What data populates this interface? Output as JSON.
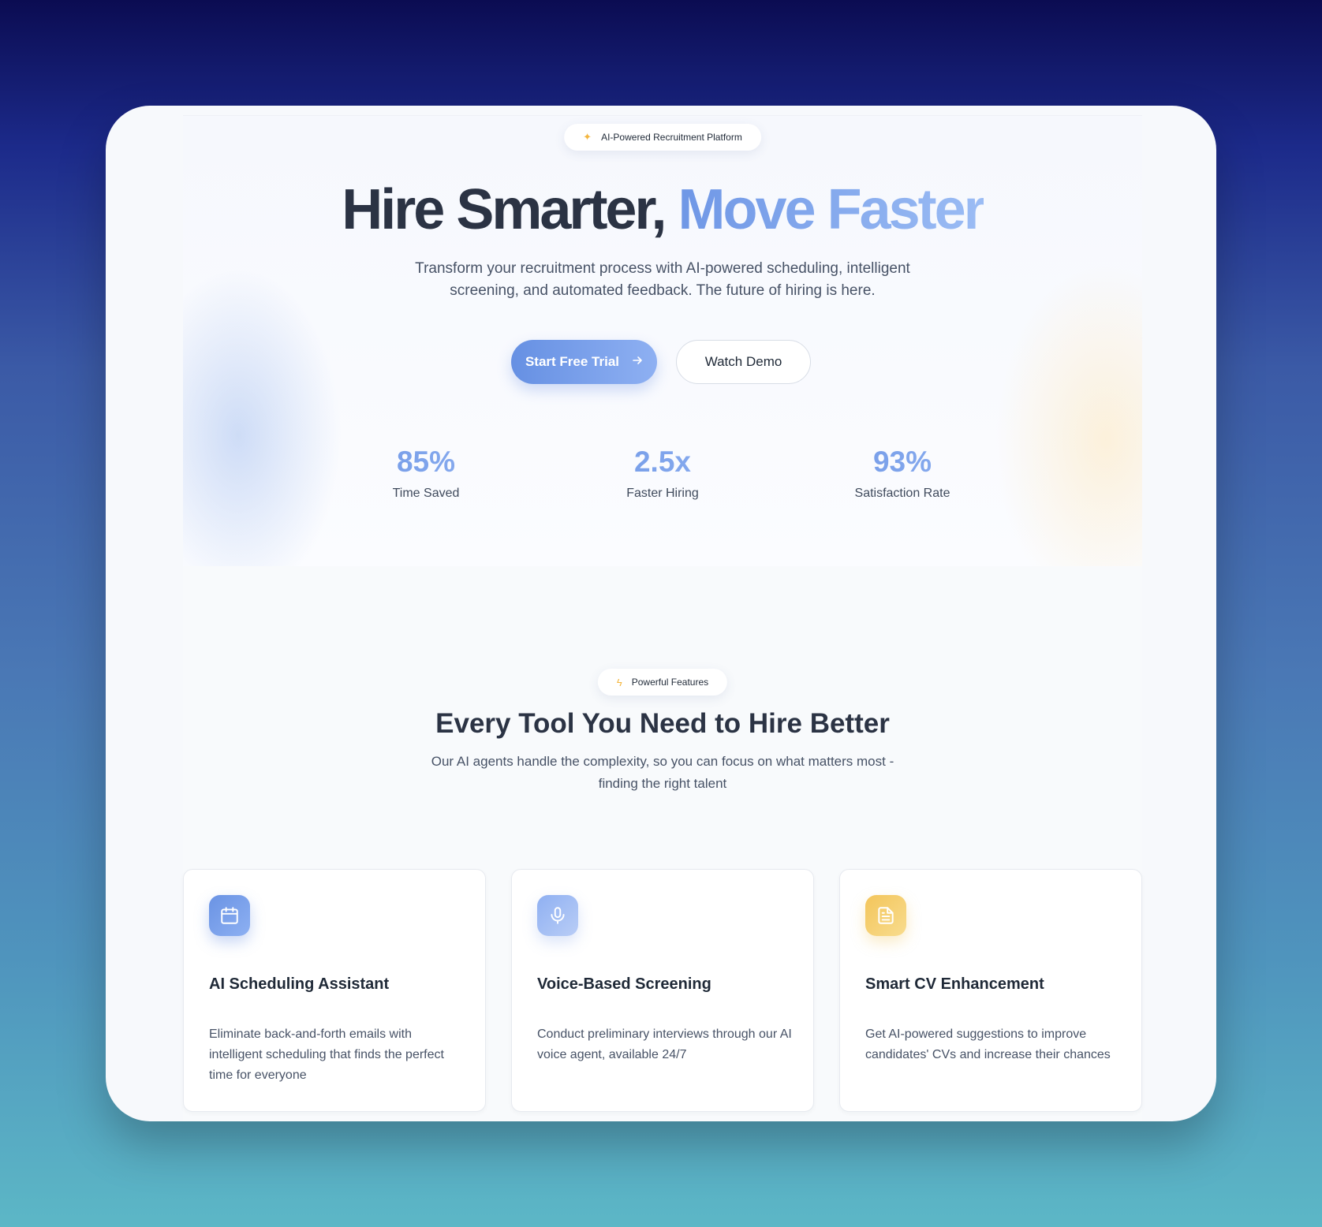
{
  "hero": {
    "badge_text": "AI-Powered Recruitment Platform",
    "badge_icon": "sparkles-icon",
    "headline_part1": "Hire Smarter,",
    "headline_part2": "Move Faster",
    "subtitle": "Transform your recruitment process with AI-powered scheduling, intelligent screening, and automated feedback. The future of hiring is here.",
    "primary_cta": "Start Free Trial",
    "primary_cta_icon": "arrow-right-icon",
    "secondary_cta": "Watch Demo",
    "stats": [
      {
        "value": "85%",
        "label": "Time Saved"
      },
      {
        "value": "2.5x",
        "label": "Faster Hiring"
      },
      {
        "value": "93%",
        "label": "Satisfaction Rate"
      }
    ]
  },
  "features": {
    "badge_text": "Powerful Features",
    "badge_icon": "lightning-icon",
    "title": "Every Tool You Need to Hire Better",
    "subtitle": "Our AI agents handle the complexity, so you can focus on what matters most - finding the right talent",
    "cards": [
      {
        "icon": "calendar-icon",
        "title": "AI Scheduling Assistant",
        "description": "Eliminate back-and-forth emails with intelligent scheduling that finds the perfect time for everyone"
      },
      {
        "icon": "microphone-icon",
        "title": "Voice-Based Screening",
        "description": "Conduct preliminary interviews through our AI voice agent, available 24/7"
      },
      {
        "icon": "document-icon",
        "title": "Smart CV Enhancement",
        "description": "Get AI-powered suggestions to improve candidates' CVs and increase their chances"
      }
    ]
  },
  "colors": {
    "accent_blue": "#6f97e6",
    "accent_yellow": "#f4c95d",
    "heading": "#2b3344"
  }
}
